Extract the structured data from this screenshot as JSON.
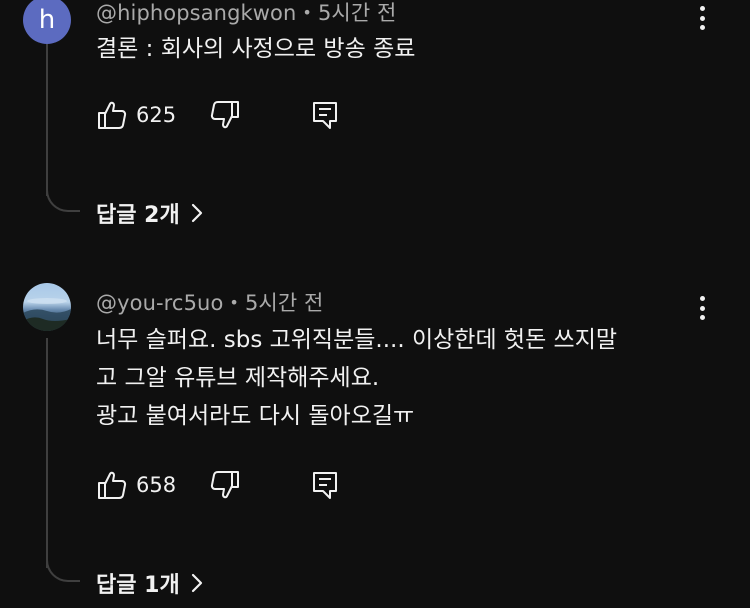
{
  "comments": [
    {
      "avatar_letter": "h",
      "author": "@hiphopsangkwon",
      "separator": "•",
      "time": "5시간 전",
      "lines": [
        "결론 : 회사의 사정으로 방송 종료"
      ],
      "likes": "625",
      "replies_label": "답글 2개"
    },
    {
      "avatar_letter": "",
      "author": "@you-rc5uo",
      "separator": "•",
      "time": "5시간 전",
      "lines": [
        "너무 슬퍼요. sbs 고위직분들.... 이상한데 헛돈 쓰지말",
        "고 그알 유튜브 제작해주세요.",
        "광고 붙여서라도 다시 돌아오길ㅠ"
      ],
      "likes": "658",
      "replies_label": "답글 1개"
    }
  ],
  "icons": {
    "like": "thumbs-up-icon",
    "dislike": "thumbs-down-icon",
    "reply": "reply-comment-icon",
    "more": "more-vert-icon",
    "chevron": "chevron-right-icon"
  },
  "colors": {
    "background": "#0f0f0f",
    "text": "#f1f1f1",
    "secondary": "#aaaaaa",
    "avatar_h": "#5c6bc0",
    "thread_line": "#3f3f3f"
  }
}
